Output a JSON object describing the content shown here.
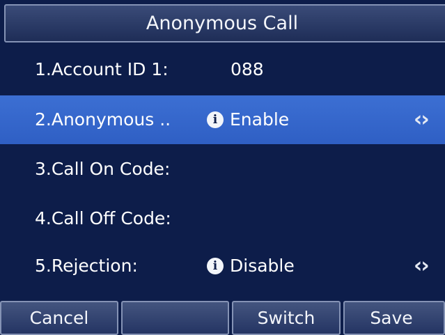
{
  "screen": {
    "title": "Anonymous Call"
  },
  "rows": [
    {
      "label": "1.Account ID 1:",
      "value": "088"
    },
    {
      "label": "2.Anonymous ..",
      "value": "Enable",
      "info_icon": "info-icon",
      "arrows": "‹›",
      "selected": true
    },
    {
      "label": "3.Call On Code:",
      "value": ""
    },
    {
      "label": "4.Call Off Code:",
      "value": ""
    },
    {
      "label": "5.Rejection:",
      "value": "Disable",
      "info_icon": "info-icon",
      "arrows": "‹›"
    }
  ],
  "softkeys": [
    {
      "label": "Cancel"
    },
    {
      "label": ""
    },
    {
      "label": "Switch"
    },
    {
      "label": "Save"
    }
  ],
  "colors": {
    "background": "#0d1d4a",
    "selected_row": "#2f5fc4",
    "softkey_border": "#8593b5"
  }
}
